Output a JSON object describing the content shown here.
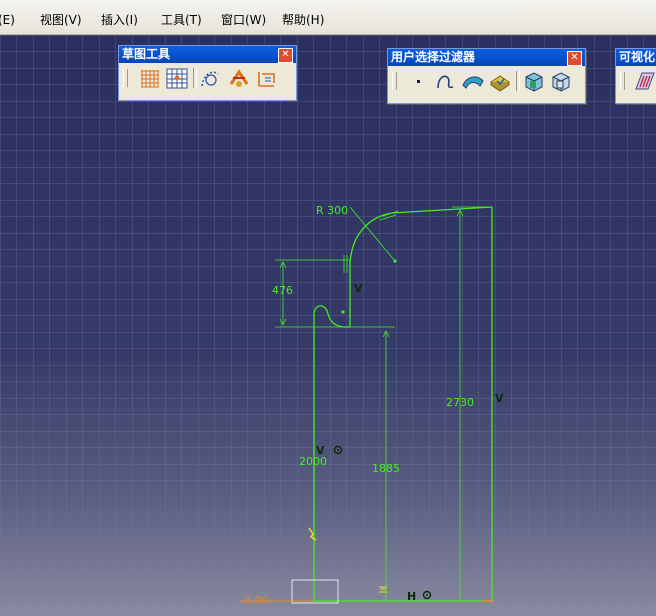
{
  "menubar": {
    "items": [
      "编辑(E)",
      "视图(V)",
      "插入(I)",
      "工具(T)",
      "窗口(W)",
      "帮助(H)"
    ]
  },
  "toolbars": {
    "sketch_tools": {
      "title": "草图工具",
      "icons": [
        "grid-icon",
        "snap-to-point-icon",
        "construction-element-icon",
        "geometric-constraints-icon",
        "dimensional-constraints-icon"
      ]
    },
    "user_selection_filter": {
      "title": "用户选择过滤器",
      "icons": [
        "point-filter-icon",
        "curve-filter-icon",
        "surface-filter-icon",
        "volume-filter-icon",
        "feature-element-filter-icon",
        "geometric-element-filter-icon"
      ]
    },
    "visualization": {
      "title": "可视化"
    }
  },
  "sketch": {
    "dimensions": {
      "radius": "R 300",
      "height_left": "476",
      "height_right": "2730",
      "height_inner": "1885",
      "height_outer": "2000",
      "origin_label": "0.00"
    },
    "constraint_labels": {
      "v_small": "V",
      "v_right": "V",
      "v_left": "V",
      "h_bottom": "H"
    }
  },
  "colors": {
    "sketch_line": "#44ee22",
    "constraint_symbol": "#0a2a0a",
    "canvas_top": "#2b2f60",
    "canvas_bottom": "#8a8aa0",
    "titlebar": "#0a5fe0"
  }
}
